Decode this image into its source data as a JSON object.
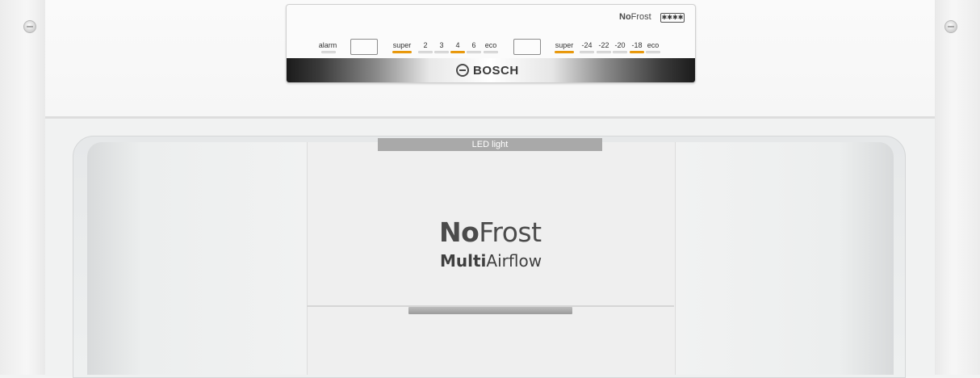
{
  "panel": {
    "badge_text": "NoFrost",
    "badge_no": "No",
    "badge_frost": "Frost",
    "star_badge": "✱✱✱✱",
    "brand": "BOSCH",
    "alarm_label": "alarm",
    "fridge_controls": [
      {
        "label": "super",
        "active": true
      },
      {
        "label": "2",
        "active": false
      },
      {
        "label": "3",
        "active": false
      },
      {
        "label": "4",
        "active": true
      },
      {
        "label": "6",
        "active": false
      },
      {
        "label": "eco",
        "active": false
      }
    ],
    "freezer_controls": [
      {
        "label": "super",
        "active": true
      },
      {
        "label": "-24",
        "active": false
      },
      {
        "label": "-22",
        "active": false
      },
      {
        "label": "-20",
        "active": false
      },
      {
        "label": "-18",
        "active": true
      },
      {
        "label": "eco",
        "active": false
      }
    ],
    "accent_color": "#f0a01d"
  },
  "interior": {
    "led_label": "LED light",
    "nofrost_bold": "No",
    "nofrost_rest": "Frost",
    "multi_bold": "Multi",
    "multi_rest": "Airflow"
  }
}
